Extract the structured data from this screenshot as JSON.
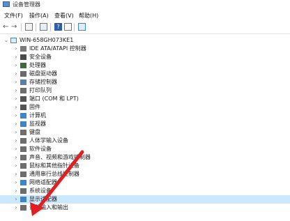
{
  "window": {
    "title": "设备管理器"
  },
  "menu": [
    "文件(F)",
    "操作(A)",
    "查看(V)",
    "帮助(H)"
  ],
  "toolbar": [
    {
      "name": "back-icon",
      "glyph": "←"
    },
    {
      "name": "forward-icon",
      "glyph": "→"
    },
    {
      "name": "properties-icon",
      "glyph": ""
    },
    {
      "name": "view-icon",
      "glyph": ""
    },
    {
      "name": "help-icon",
      "glyph": "?"
    },
    {
      "name": "scan-icon",
      "glyph": ""
    },
    {
      "name": "monitor-icon",
      "glyph": ""
    }
  ],
  "tree": {
    "root": "WIN-658GH073KE1",
    "items": [
      {
        "label": "IDE ATA/ATAPI 控制器",
        "icon": "ide-icon",
        "color": "#7a7a7a"
      },
      {
        "label": "安全设备",
        "icon": "security-icon",
        "color": "#4a4a4a"
      },
      {
        "label": "处理器",
        "icon": "processor-icon",
        "color": "#3d6b3d"
      },
      {
        "label": "磁盘驱动器",
        "icon": "disk-icon",
        "color": "#6a6a6a"
      },
      {
        "label": "存储控制器",
        "icon": "storage-icon",
        "color": "#5b7fa6"
      },
      {
        "label": "打印队列",
        "icon": "printer-icon",
        "color": "#6d6d6d"
      },
      {
        "label": "端口 (COM 和 LPT)",
        "icon": "port-icon",
        "color": "#555555"
      },
      {
        "label": "固件",
        "icon": "firmware-icon",
        "color": "#555555"
      },
      {
        "label": "计算机",
        "icon": "computer-icon",
        "color": "#3a86c8"
      },
      {
        "label": "监视器",
        "icon": "monitor-icon",
        "color": "#3a86c8"
      },
      {
        "label": "键盘",
        "icon": "keyboard-icon",
        "color": "#6d6d6d"
      },
      {
        "label": "人体学输入设备",
        "icon": "hid-icon",
        "color": "#6d6d6d"
      },
      {
        "label": "软件设备",
        "icon": "software-device-icon",
        "color": "#6d6d6d"
      },
      {
        "label": "声音、视频和游戏控制器",
        "icon": "audio-icon",
        "color": "#6d6d6d"
      },
      {
        "label": "鼠标和其他指针设备",
        "icon": "mouse-icon",
        "color": "#6d6d6d"
      },
      {
        "label": "通用串行总线控制器",
        "icon": "usb-icon",
        "color": "#6d6d6d"
      },
      {
        "label": "网络适配器",
        "icon": "network-icon",
        "color": "#3a86c8"
      },
      {
        "label": "系统设备",
        "icon": "system-device-icon",
        "color": "#6d6d6d"
      },
      {
        "label": "显示适配器",
        "icon": "display-adapter-icon",
        "color": "#3a86c8"
      },
      {
        "label": "音频输入和输出",
        "icon": "audio-io-icon",
        "color": "#6d6d6d"
      }
    ]
  },
  "colors": {
    "selection": "#cce8ff",
    "arrow": "#e02020"
  }
}
